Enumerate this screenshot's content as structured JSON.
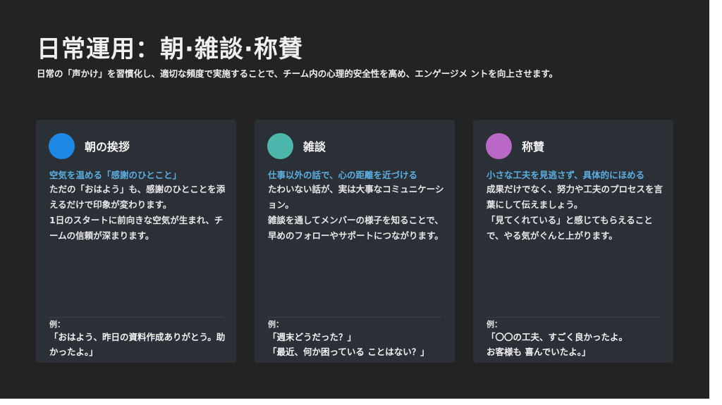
{
  "title": "日常運用：朝·雑談·称賛",
  "subtitle": "日常の「声かけ」を習慣化し、適切な頻度で実施することで、チーム内の心理的安全性を高め、エンゲージメ ントを向上させます。",
  "colors": {
    "background": "#232323",
    "card": "#2b2f36",
    "highlight": "#5aaee0",
    "dot_blue": "#1e88e5",
    "dot_teal": "#4db6ac",
    "dot_purple": "#ba68c8"
  },
  "cards": [
    {
      "title": "朝の挨拶",
      "highlight": "空気を温める「感謝のひとこと」",
      "body": [
        "ただの「おはよう」も、感謝のひとことを添えるだけで印象が変わります。",
        " 1日のスタートに前向きな空気が生まれ、チームの信頼が深まります。"
      ],
      "example_label": "例：",
      "examples": [
        "「おはよう、昨日の資料作成ありがとう。助 かったよ。」"
      ]
    },
    {
      "title": "雑談",
      "highlight": "仕事以外の話で、心の距離を近づける",
      "body": [
        "たわいない話が、実は大事なコミュニケーション。",
        " 雑談を通してメンバーの様子を知ることで、早めのフォローやサポートにつながります。"
      ],
      "example_label": "例：",
      "examples": [
        "「週末どうだった？」",
        "「最近、何か困っている ことはない？」"
      ]
    },
    {
      "title": "称賛",
      "highlight": "小さな工夫を見逃さず、具体的にほめる",
      "body": [
        "成果だけでなく、努力や工夫のプロセスを言葉にして伝えましょう。",
        " 「見てくれている」と感じてもらえることで、やる気がぐんと上がります。"
      ],
      "example_label": "例：",
      "examples": [
        "「〇〇の工夫、すごく良かったよ。",
        "お客様も 喜んでいたよ。」"
      ]
    }
  ]
}
